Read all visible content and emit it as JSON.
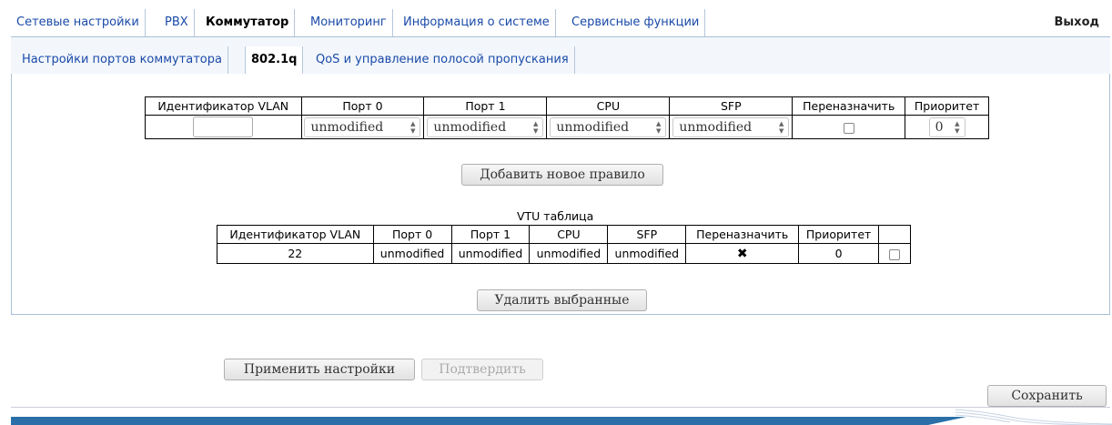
{
  "top_nav": {
    "tabs": [
      {
        "label": "Сетевые настройки"
      },
      {
        "label": "PBX"
      },
      {
        "label": "Коммутатор"
      },
      {
        "label": "Мониторинг"
      },
      {
        "label": "Информация о системе"
      },
      {
        "label": "Сервисные функции"
      }
    ],
    "active_tab": "Коммутатор",
    "exit_label": "Выход"
  },
  "sub_nav": {
    "tabs": [
      {
        "label": "Настройки портов коммутатора"
      },
      {
        "label": "802.1q"
      },
      {
        "label": "QoS и управление полосой пропускания"
      }
    ],
    "active_tab": "802.1q"
  },
  "rule_table": {
    "headers": [
      "Идентификатор VLAN",
      "Порт 0",
      "Порт 1",
      "CPU",
      "SFP",
      "Переназначить",
      "Приоритет"
    ],
    "vlan_id_value": "",
    "port0": "unmodified",
    "port1": "unmodified",
    "cpu": "unmodified",
    "sfp": "unmodified",
    "reassign_checked": false,
    "priority": "0"
  },
  "add_rule_button": "Добавить новое правило",
  "vtu_table": {
    "caption": "VTU таблица",
    "headers": [
      "Идентификатор VLAN",
      "Порт 0",
      "Порт 1",
      "CPU",
      "SFP",
      "Переназначить",
      "Приоритет",
      ""
    ],
    "rows": [
      {
        "vlan": "22",
        "port0": "unmodified",
        "port1": "unmodified",
        "cpu": "unmodified",
        "sfp": "unmodified",
        "reassign": "✖",
        "priority": "0"
      }
    ]
  },
  "delete_selected_button": "Удалить выбранные",
  "apply_button": "Применить настройки",
  "confirm_button": "Подтвердить",
  "save_button": "Сохранить",
  "colors": {
    "link": "#1a4aa8",
    "footer_bar": "#2a6fa8",
    "border": "#a9bfd6"
  }
}
